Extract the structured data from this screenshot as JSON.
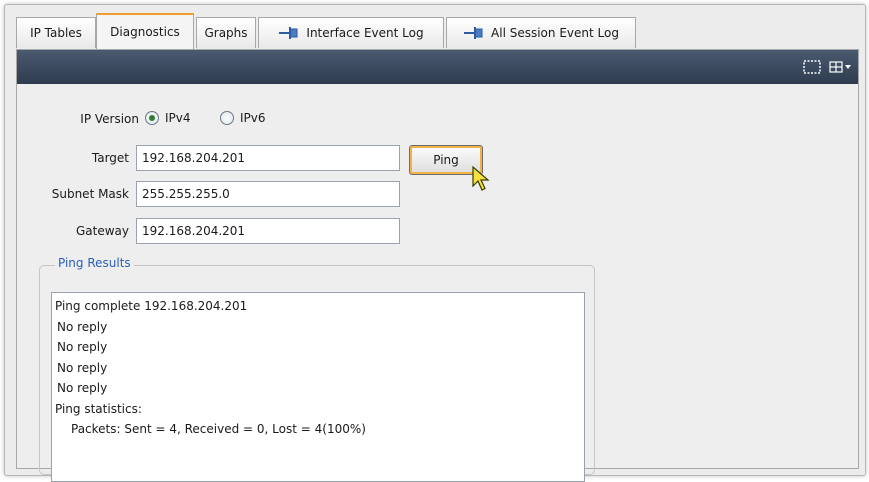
{
  "tabs": [
    {
      "label": "IP Tables",
      "active": false,
      "pinned": false
    },
    {
      "label": "Diagnostics",
      "active": true,
      "pinned": false
    },
    {
      "label": "Graphs",
      "active": false,
      "pinned": false
    },
    {
      "label": "Interface Event Log",
      "active": false,
      "pinned": true
    },
    {
      "label": "All Session Event Log",
      "active": false,
      "pinned": true
    }
  ],
  "header": {
    "icons": [
      "selection-rect-icon",
      "columns-menu-icon"
    ]
  },
  "form": {
    "ip_version_label": "IP Version",
    "ip_version_options": [
      "IPv4",
      "IPv6"
    ],
    "ip_version_selected": "IPv4",
    "target_label": "Target",
    "target_value": "192.168.204.201",
    "ping_button": "Ping",
    "subnet_label": "Subnet Mask",
    "subnet_value": "255.255.255.0",
    "gateway_label": "Gateway",
    "gateway_value": "192.168.204.201"
  },
  "results": {
    "title": "Ping Results",
    "lines": [
      "Ping complete 192.168.204.201",
      "No reply",
      "No reply",
      "No reply",
      "No reply",
      "Ping statistics:",
      "Packets: Sent = 4, Received = 0, Lost = 4(100%)"
    ]
  },
  "colors": {
    "header_bar": "#2f3c4f",
    "active_tab_accent": "#f0a030",
    "legend_text": "#2a5fb8",
    "radio_selected": "#2f7d32"
  }
}
